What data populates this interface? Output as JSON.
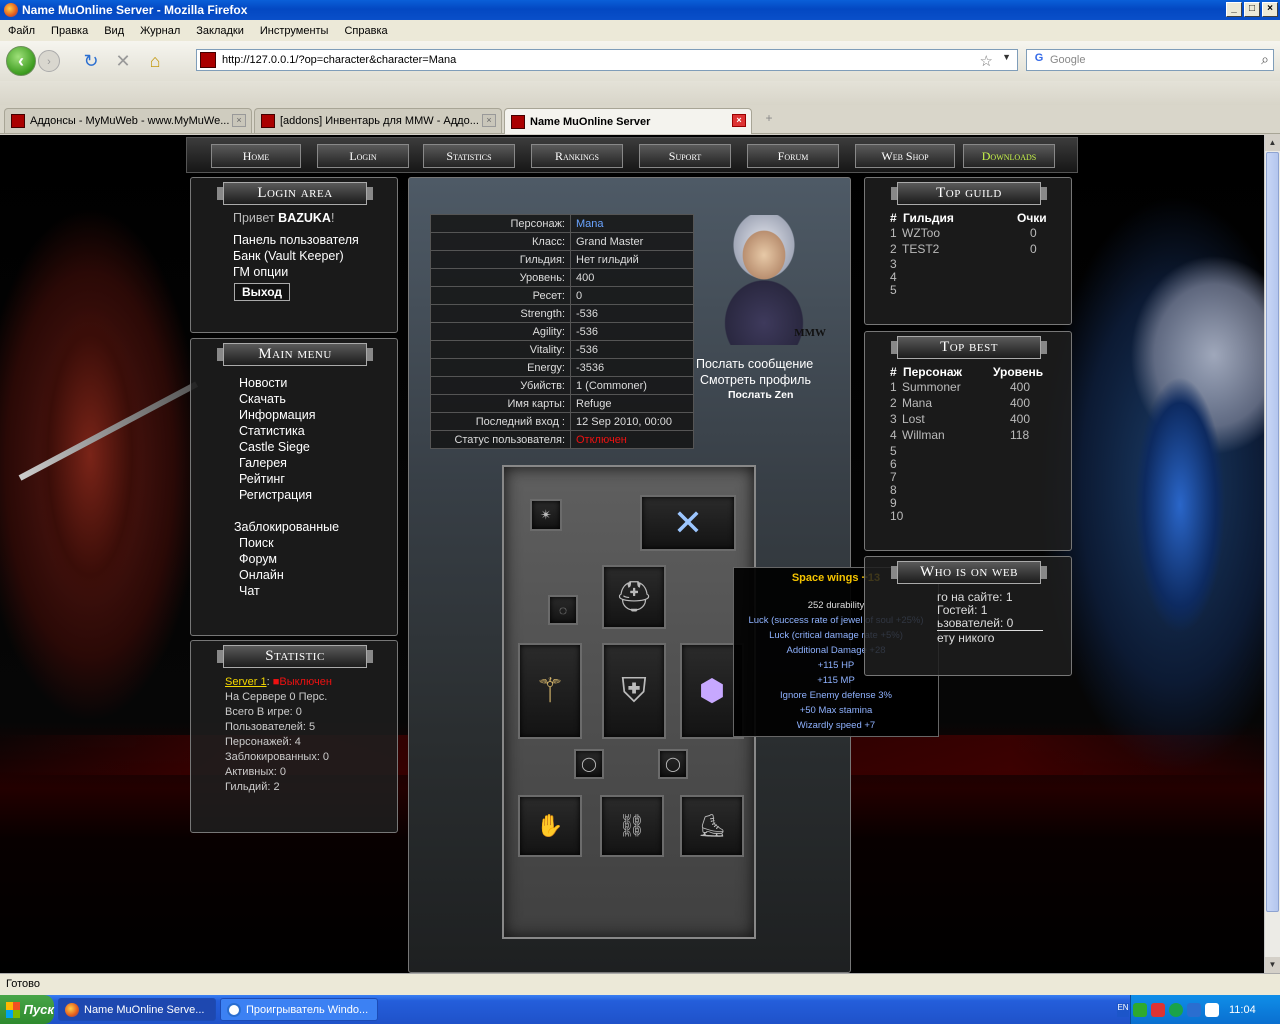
{
  "window": {
    "title": "Name MuOnline Server - Mozilla Firefox"
  },
  "menu": [
    "Файл",
    "Правка",
    "Вид",
    "Журнал",
    "Закладки",
    "Инструменты",
    "Справка"
  ],
  "url": "http://127.0.0.1/?op=character&character=Mana",
  "search_placeholder": "Google",
  "tabs": [
    {
      "label": "Аддонсы - MyMuWeb - www.MyMuWe..."
    },
    {
      "label": "[addons] Инвентарь для MMW - Аддо..."
    },
    {
      "label": "Name MuOnline Server"
    }
  ],
  "status": "Готово",
  "taskbar": {
    "start": "Пуск",
    "items": [
      "Name MuOnline Serve...",
      "Проигрыватель Windo..."
    ],
    "lang": "EN",
    "clock": "11:04"
  },
  "site": {
    "nav": [
      "Home",
      "Login",
      "Statistics",
      "Rankings",
      "Suport",
      "Forum",
      "Web Shop",
      "Downloads"
    ],
    "login": {
      "title": "Login area",
      "greeting": "Привет",
      "user": "BAZUKA",
      "links": [
        "Панель пользователя",
        "Банк (Vault Keeper)",
        "ГМ опции"
      ],
      "logout": "Выход"
    },
    "main_menu": {
      "title": "Main menu",
      "items": [
        "Новости",
        "Скачать",
        "Информация",
        "Статистика",
        "Castle Siege",
        "Галерея",
        "Рейтинг",
        "Регистрация"
      ],
      "items2": [
        "Заблокированные",
        "Поиск",
        "Форум",
        "Онлайн",
        "Чат"
      ]
    },
    "statistic": {
      "title": "Statistic",
      "server": "Server 1",
      "server_status": "Выключен",
      "lines": [
        "На Сервере 0 Перс.",
        "Всего В игре: 0",
        "Пользователей: 5",
        "Персонажей: 4",
        "Заблокированных: 0",
        "Активных: 0",
        "Гильдий: 2"
      ]
    },
    "character": {
      "rows": [
        {
          "k": "Персонаж:",
          "v": "Mana"
        },
        {
          "k": "Класс:",
          "v": "Grand Master"
        },
        {
          "k": "Гильдия:",
          "v": "Нет гильдий"
        },
        {
          "k": "Уровень:",
          "v": "400"
        },
        {
          "k": "Ресет:",
          "v": "0"
        },
        {
          "k": "Strength:",
          "v": "-536"
        },
        {
          "k": "Agility:",
          "v": "-536"
        },
        {
          "k": "Vitality:",
          "v": "-536"
        },
        {
          "k": "Energy:",
          "v": "-3536"
        },
        {
          "k": "Убийств:",
          "v": "1 (Commoner)"
        },
        {
          "k": "Имя карты:",
          "v": "Refuge"
        },
        {
          "k": "Последний вход :",
          "v": "12 Sep 2010, 00:00"
        },
        {
          "k": "Статус пользователя:",
          "v": "Отключен"
        }
      ],
      "avatar_sign": "MMW",
      "send_message": "Послать сообщение",
      "view_profile": "Смотреть профиль",
      "send_zen": "Послать Zen"
    },
    "tooltip": {
      "title": "Space wings +13",
      "durability": "252 durability",
      "lines": [
        "Luck (success rate of jewel of soul +25%)",
        "Luck (critical damage rate +5%)",
        "Additional Damage +28",
        "+115 HP",
        "+115 MP",
        "Ignore Enemy defense 3%",
        "+50 Max stamina",
        "Wizardly speed +7"
      ]
    },
    "top_guild": {
      "title": "Top guild",
      "h_num": "#",
      "h_name": "Гильдия",
      "h_score": "Очки",
      "rows": [
        {
          "n": "1",
          "name": "WZToo",
          "v": "0"
        },
        {
          "n": "2",
          "name": "TEST2",
          "v": "0"
        },
        {
          "n": "3",
          "name": "",
          "v": ""
        },
        {
          "n": "4",
          "name": "",
          "v": ""
        },
        {
          "n": "5",
          "name": "",
          "v": ""
        }
      ]
    },
    "top_best": {
      "title": "Top best",
      "h_num": "#",
      "h_name": "Персонаж",
      "h_level": "Уровень",
      "rows": [
        {
          "n": "1",
          "name": "Summoner",
          "v": "400"
        },
        {
          "n": "2",
          "name": "Mana",
          "v": "400"
        },
        {
          "n": "3",
          "name": "Lost",
          "v": "400"
        },
        {
          "n": "4",
          "name": "Willman",
          "v": "118"
        },
        {
          "n": "5",
          "name": "",
          "v": ""
        },
        {
          "n": "6",
          "name": "",
          "v": ""
        },
        {
          "n": "7",
          "name": "",
          "v": ""
        },
        {
          "n": "8",
          "name": "",
          "v": ""
        },
        {
          "n": "9",
          "name": "",
          "v": ""
        },
        {
          "n": "10",
          "name": "",
          "v": ""
        }
      ]
    },
    "who_online": {
      "title": "Who is on web",
      "lines": [
        "го на сайте: 1",
        "Гостей: 1",
        "ьзователей: 0",
        "ету никого"
      ]
    }
  }
}
